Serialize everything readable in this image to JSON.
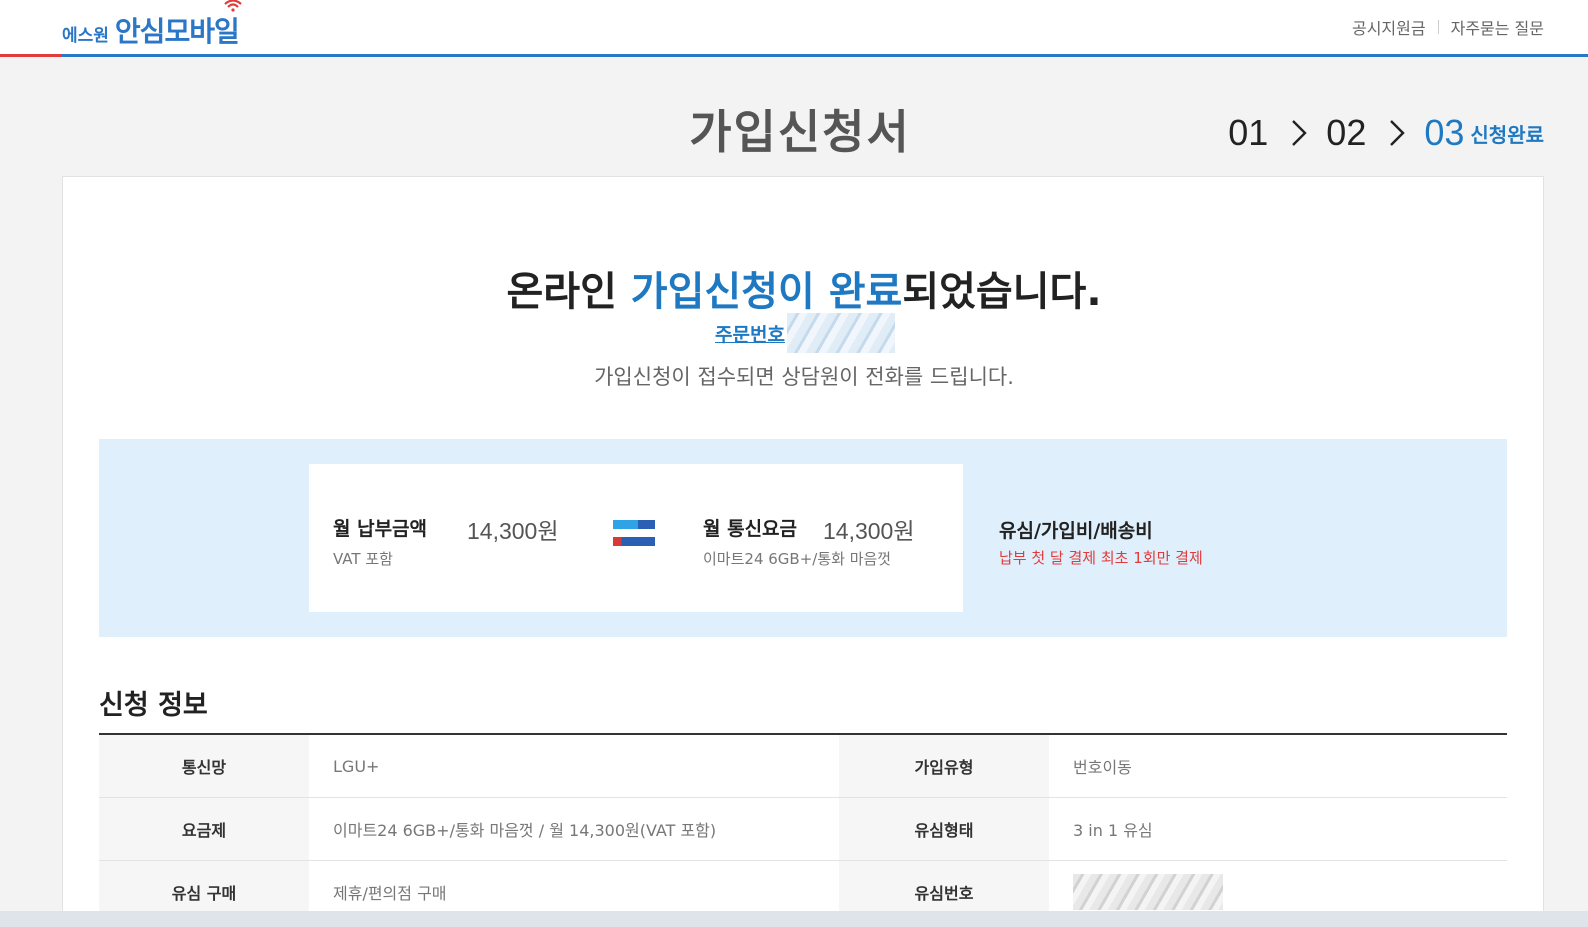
{
  "header": {
    "logo_small": "에스원",
    "logo_big": "안심모바일",
    "links": [
      "공시지원금",
      "자주묻는 질문"
    ]
  },
  "page_title": "가입신청서",
  "steps": {
    "items": [
      "01",
      "02",
      "03"
    ],
    "current_label": "신청완료"
  },
  "completion": {
    "title_prefix": "온라인 ",
    "title_highlight": "가입신청이 완료",
    "title_suffix": "되었습니다.",
    "order_label": "주문번호",
    "subtitle": "가입신청이 접수되면 상담원이 전화를 드립니다."
  },
  "price": {
    "monthly_payment_label": "월 납부금액",
    "monthly_payment_value": "14,300원",
    "monthly_payment_note": "VAT 포함",
    "monthly_fee_label": "월 통신요금",
    "monthly_fee_value": "14,300원",
    "monthly_fee_note": "이마트24 6GB+/통화 마음껏",
    "extra_title": "유심/가입비/배송비",
    "extra_note": "납부 첫 달 결제 최초 1회만 결제"
  },
  "info": {
    "section_title": "신청 정보",
    "rows": [
      {
        "h1": "통신망",
        "v1": "LGU+",
        "h2": "가입유형",
        "v2": "번호이동"
      },
      {
        "h1": "요금제",
        "v1": "이마트24 6GB+/통화 마음껏 / 월 14,300원(VAT 포함)",
        "h2": "유심형태",
        "v2": "3 in 1 유심"
      },
      {
        "h1": "유심 구매",
        "v1": "제휴/편의점 구매",
        "h2": "유심번호",
        "v2": ""
      }
    ]
  },
  "colors": {
    "brand_blue": "#1e78c2",
    "accent_red": "#e03c3c",
    "price_bg": "#dff0fc"
  }
}
